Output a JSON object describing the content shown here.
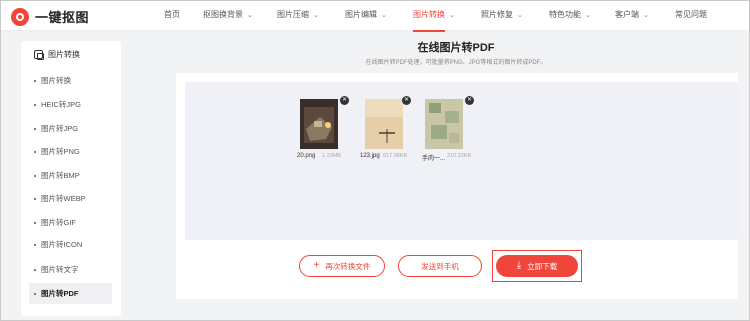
{
  "app": {
    "name": "一键抠图"
  },
  "nav": {
    "items": [
      {
        "label": "首页",
        "chevron": false,
        "active": false
      },
      {
        "label": "抠图换背景",
        "chevron": true,
        "active": false
      },
      {
        "label": "图片压缩",
        "chevron": true,
        "active": false
      },
      {
        "label": "图片编辑",
        "chevron": true,
        "active": false
      },
      {
        "label": "图片转换",
        "chevron": true,
        "active": true
      },
      {
        "label": "照片修复",
        "chevron": true,
        "active": false
      },
      {
        "label": "特色功能",
        "chevron": true,
        "active": false
      },
      {
        "label": "客户端",
        "chevron": true,
        "active": false
      },
      {
        "label": "常见问题",
        "chevron": false,
        "active": false
      }
    ]
  },
  "sidebar": {
    "title": "图片转换",
    "items": [
      {
        "label": "图片转换",
        "active": false
      },
      {
        "label": "HEIC转JPG",
        "active": false
      },
      {
        "label": "图片转JPG",
        "active": false
      },
      {
        "label": "图片转PNG",
        "active": false
      },
      {
        "label": "图片转BMP",
        "active": false
      },
      {
        "label": "图片转WEBP",
        "active": false
      },
      {
        "label": "图片转GIF",
        "active": false
      },
      {
        "label": "图片转ICON",
        "active": false
      },
      {
        "label": "图片转文字",
        "active": false
      },
      {
        "label": "图片转PDF",
        "active": true
      }
    ]
  },
  "main": {
    "title": "在线图片转PDF",
    "subtitle": "在线图片转PDF处理，可批量将PNG、JPG等格式的图片转成PDF。",
    "files": [
      {
        "name": "20.png",
        "size": "1.23MB"
      },
      {
        "name": "123.jpg",
        "size": "617.98KB"
      },
      {
        "name": "手肉一...",
        "size": "210.22KB"
      }
    ],
    "close_glyph": "✕"
  },
  "actions": {
    "convert_again": "再次转换文件",
    "send_phone": "发送到手机",
    "download": "立即下载"
  },
  "colors": {
    "accent": "#f0453a",
    "drop_bg": "#eff1f7"
  }
}
